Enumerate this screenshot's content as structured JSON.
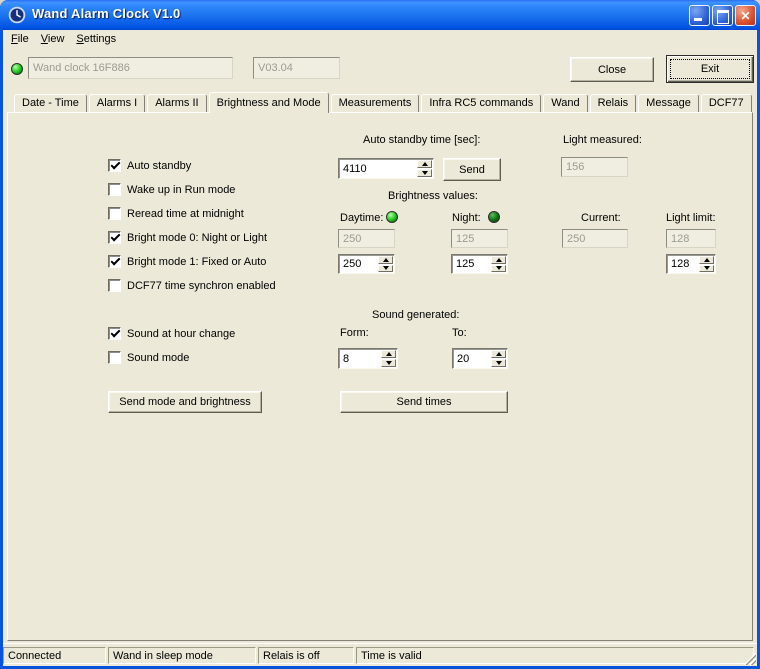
{
  "window": {
    "title": "Wand Alarm Clock V1.0"
  },
  "menu": {
    "items": [
      {
        "label": "File"
      },
      {
        "label": "View"
      },
      {
        "label": "Settings"
      }
    ]
  },
  "header": {
    "device_name": "Wand clock 16F886",
    "firmware_version": "V03.04",
    "close_button": "Close",
    "exit_button": "Exit"
  },
  "tabs": {
    "active": "Brightness and Mode",
    "items": [
      "Date - Time",
      "Alarms I",
      "Alarms II",
      "Brightness and Mode",
      "Measurements",
      "Infra RC5 commands",
      "Wand",
      "Relais",
      "Message",
      "DCF77"
    ]
  },
  "panel": {
    "mode_checkboxes": [
      {
        "label": "Auto standby",
        "checked": true
      },
      {
        "label": "Wake up in Run mode",
        "checked": false
      },
      {
        "label": "Reread time at midnight",
        "checked": false
      },
      {
        "label": "Bright mode 0: Night or Light",
        "checked": true
      },
      {
        "label": "Bright mode 1: Fixed or Auto",
        "checked": true
      },
      {
        "label": "DCF77 time synchron enabled",
        "checked": false
      }
    ],
    "sound_checkboxes": [
      {
        "label": "Sound at hour change",
        "checked": true
      },
      {
        "label": "Sound mode",
        "checked": false
      }
    ],
    "auto_standby_label": "Auto standby time [sec]:",
    "auto_standby_value": "4110",
    "send_button": "Send",
    "light_measured_label": "Light measured:",
    "light_measured_value": "156",
    "brightness_heading": "Brightness values:",
    "daytime_label": "Daytime:",
    "daytime_current": "250",
    "daytime_setting": "250",
    "night_label": "Night:",
    "night_current": "125",
    "night_setting": "125",
    "current_label": "Current:",
    "current_value": "250",
    "light_limit_label": "Light limit:",
    "light_limit_current": "128",
    "light_limit_setting": "128",
    "sound_generated_heading": "Sound generated:",
    "sound_from_label": "Form:",
    "sound_from_value": "8",
    "sound_to_label": "To:",
    "sound_to_value": "20",
    "send_mode_button": "Send mode and brightness",
    "send_times_button": "Send times"
  },
  "statusbar": {
    "panels": [
      "Connected",
      "Wand in sleep mode",
      "Relais is off",
      "Time is valid"
    ]
  },
  "colors": {
    "titlebar_blue": "#0054E3",
    "window_bg": "#ECE9D8",
    "led_on_green": "#2FD32F",
    "led_night_green": "#0F7A0F"
  }
}
